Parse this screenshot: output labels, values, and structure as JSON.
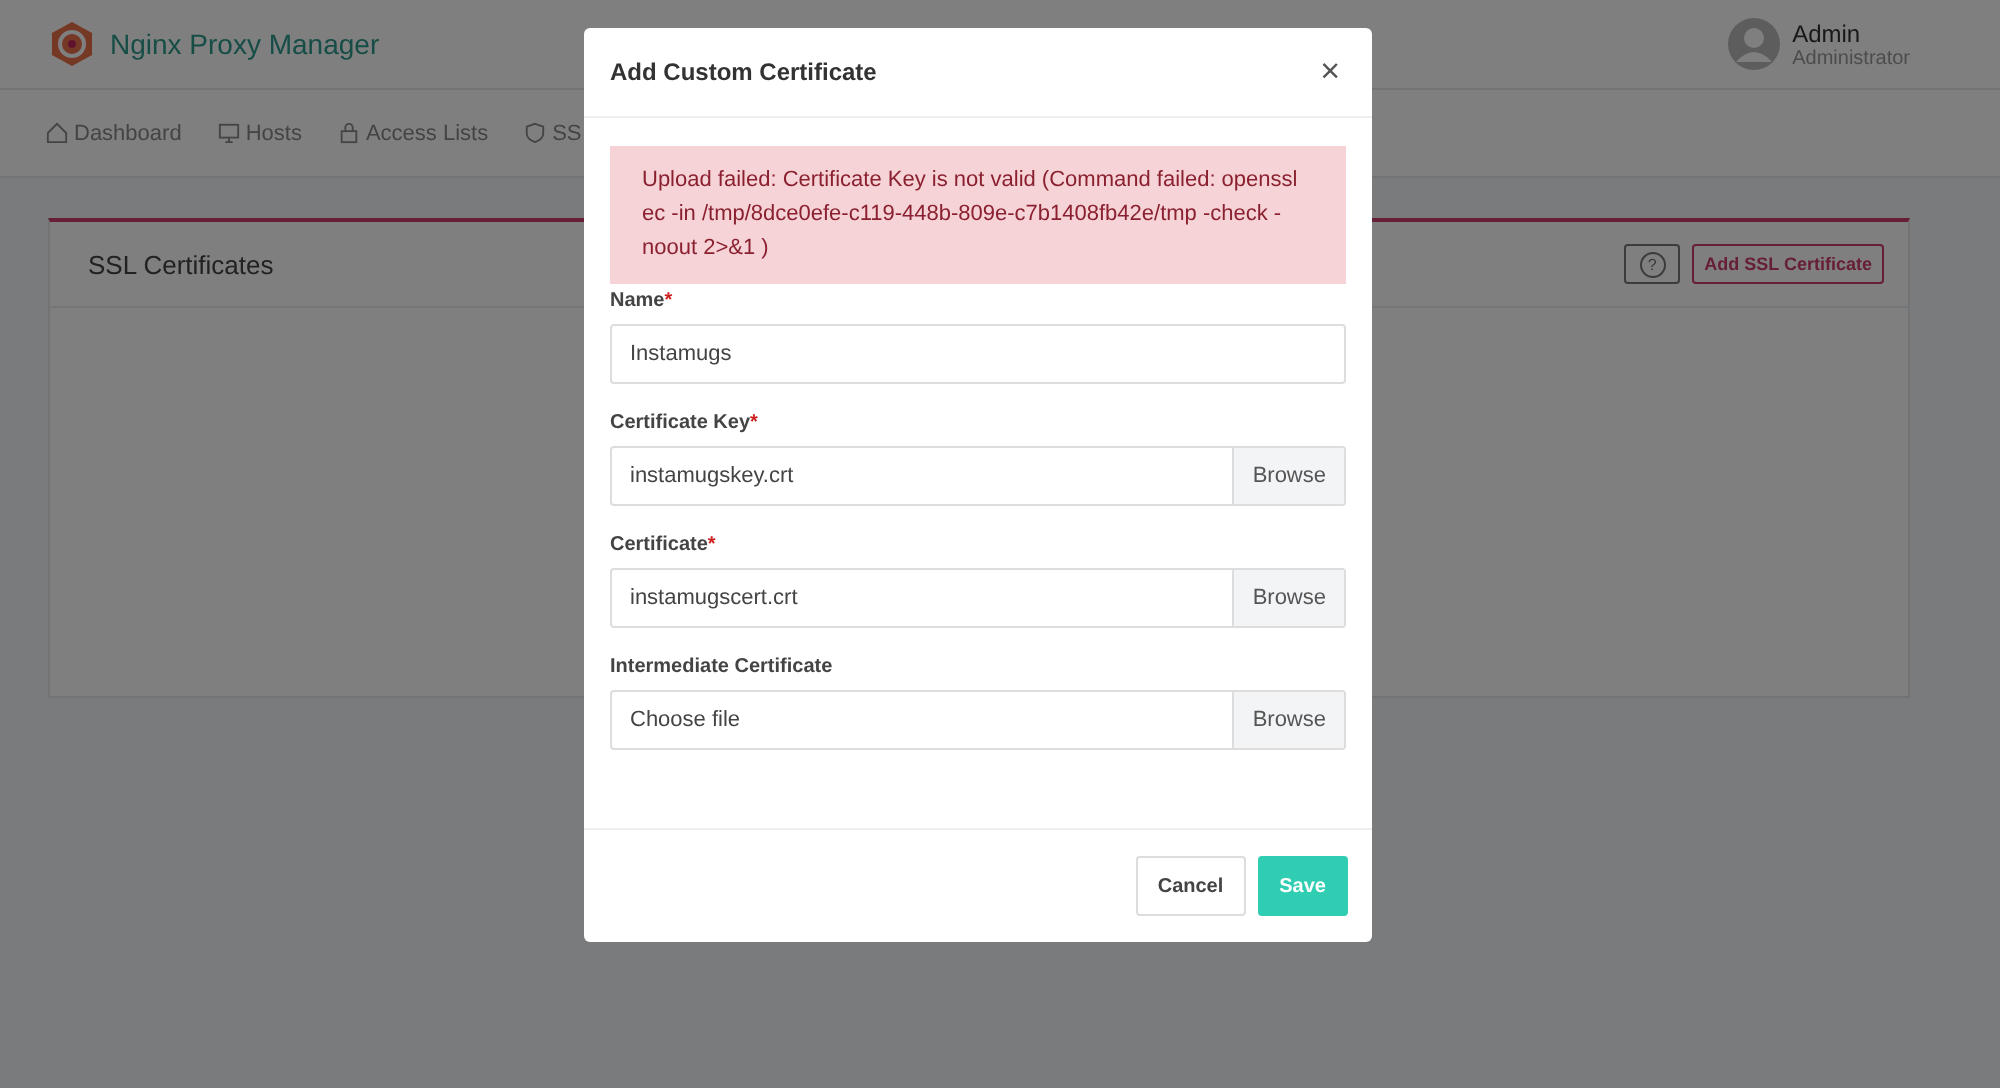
{
  "app": {
    "title": "Nginx Proxy Manager"
  },
  "user": {
    "name": "Admin",
    "role": "Administrator"
  },
  "nav": [
    {
      "label": "Dashboard"
    },
    {
      "label": "Hosts"
    },
    {
      "label": "Access Lists"
    },
    {
      "label": "SS"
    }
  ],
  "card": {
    "title": "SSL Certificates",
    "help_button": "?",
    "add_button": "Add SSL Certificate"
  },
  "modal": {
    "title": "Add Custom Certificate",
    "close": "×",
    "error": "Upload failed: Certificate Key is not valid (Command failed: openssl ec -in /tmp/8dce0efe-c119-448b-809e-c7b1408fb42e/tmp -check -noout 2>&1 )",
    "fields": [
      {
        "kind": "text",
        "label": "Name",
        "required_mark": "*",
        "value": "Instamugs"
      },
      {
        "kind": "file",
        "label": "Certificate Key",
        "required_mark": "*",
        "value": "instamugskey.crt",
        "button": "Browse"
      },
      {
        "kind": "file",
        "label": "Certificate",
        "required_mark": "*",
        "value": "instamugscert.crt",
        "button": "Browse"
      },
      {
        "kind": "file",
        "label": "Intermediate Certificate",
        "value": "Choose file",
        "button": "Browse"
      }
    ],
    "buttons": [
      {
        "label": "Cancel",
        "kind": "secondary"
      },
      {
        "label": "Save",
        "kind": "primary"
      }
    ]
  }
}
